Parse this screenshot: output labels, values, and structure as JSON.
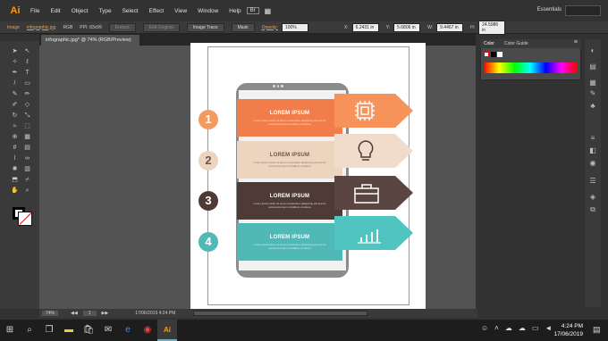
{
  "app": {
    "logo": "Ai",
    "workspace": "Essentials",
    "search_placeholder": ""
  },
  "menu": [
    "File",
    "Edit",
    "Object",
    "Type",
    "Select",
    "Effect",
    "View",
    "Window",
    "Help"
  ],
  "control_bar": {
    "label_image": "Image",
    "file_name": "infographic.jpg",
    "color_mode": "RGB",
    "ppi": "PPI: 83x99",
    "embed": "Embed",
    "edit_original": "Edit Original",
    "image_trace": "Image Trace",
    "mask": "Mask",
    "opacity_label": "Opacity:",
    "opacity_value": "100%",
    "x_label": "X:",
    "x_value": "6.2431 in",
    "y_label": "Y:",
    "y_value": "5.6806 in",
    "w_label": "W:",
    "w_value": "9.4467 in",
    "h_label": "H:",
    "h_value": "24.5986 in"
  },
  "document_tab": "infographic.jpg* @ 74% (RGB/Preview)",
  "panel": {
    "tab_color": "Color",
    "tab_guide": "Color Guide"
  },
  "infographic": {
    "items": [
      {
        "number": "1",
        "title": "LOREM IPSUM",
        "text": "Lorem ipsum dolor sit amet consectetur adipiscing elit sed do eiusmod tempor incididunt ut labore",
        "color": "#f17e4a",
        "icon": "chip-icon"
      },
      {
        "number": "2",
        "title": "LOREM IPSUM",
        "text": "Lorem ipsum dolor sit amet consectetur adipiscing elit sed do eiusmod tempor incididunt ut labore",
        "color": "#ecd4be",
        "icon": "lightbulb-icon"
      },
      {
        "number": "3",
        "title": "LOREM IPSUM",
        "text": "Lorem ipsum dolor sit amet consectetur adipiscing elit sed do eiusmod tempor incididunt ut labore",
        "color": "#4e3b36",
        "icon": "briefcase-icon"
      },
      {
        "number": "4",
        "title": "LOREM IPSUM",
        "text": "Lorem ipsum dolor sit amet consectetur adipiscing elit sed do eiusmod tempor incididunt ut labore",
        "color": "#4fb9b6",
        "icon": "bar-chart-icon"
      }
    ]
  },
  "status": {
    "zoom": "74%",
    "page": "1",
    "info": "17/06/2019 4:24 PM"
  },
  "taskbar": {
    "time": "4:24 PM",
    "date": "17/06/2019"
  }
}
